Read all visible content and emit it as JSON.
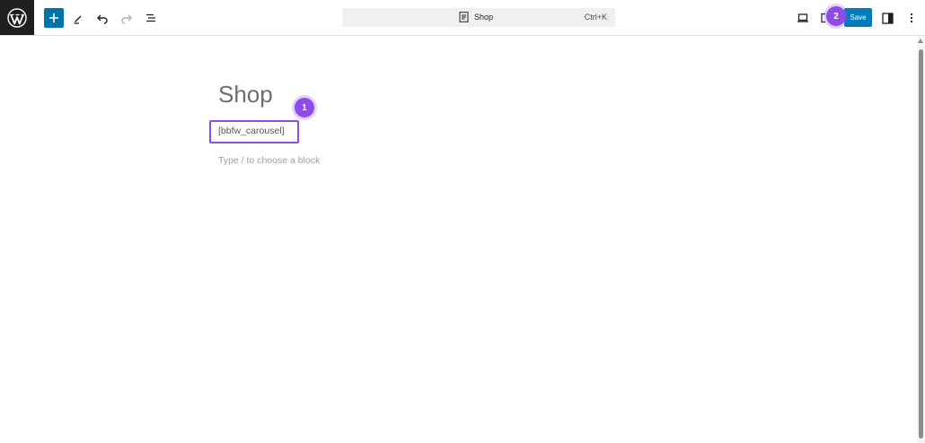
{
  "toolbar": {
    "logo_icon": "wordpress-logo-icon",
    "add_block_icon": "plus-icon",
    "tools_icon": "pencil-icon",
    "undo_icon": "undo-icon",
    "redo_icon": "redo-icon",
    "document_overview_icon": "list-view-icon",
    "command_bar": {
      "icon": "page-icon",
      "title": "Shop",
      "shortcut": "Ctrl+K"
    },
    "view_icon": "laptop-icon",
    "save_label": "Save",
    "settings_icon": "sidebar-toggle-icon",
    "options_icon": "vertical-dots-icon"
  },
  "editor": {
    "page_title": "Shop",
    "shortcode": "[bbfw_carousel]",
    "block_placeholder": "Type / to choose a block"
  },
  "annotations": {
    "step1": "1",
    "step2": "2"
  },
  "colors": {
    "accent": "#8e4be8",
    "save_button": "#007cba",
    "add_button": "#0073aa",
    "logo_bg": "#1e1e1e"
  }
}
